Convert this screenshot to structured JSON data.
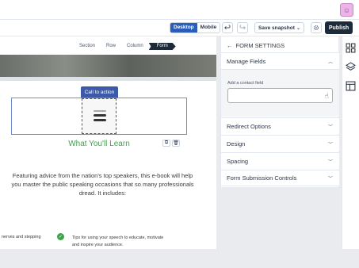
{
  "toolbar": {
    "desktop_label": "Desktop",
    "mobile_label": "Mobile",
    "undo_icon": "undo-icon",
    "redo_icon": "redo-icon",
    "save_snapshot_label": "Save snapshot",
    "settings_icon": "gear-icon",
    "publish_label": "Publish"
  },
  "canvas": {
    "breadcrumb": [
      "Section",
      "Row",
      "Column",
      "Form"
    ],
    "cta_tag": "Call to action",
    "heading": "What You'll Learn",
    "paragraph": "Featuring advice from the nation's top speakers, this e-book will help you master the public speaking occasions that so many professionals dread. It includes:",
    "bullet_left": "nerves and stepping",
    "bullet_right": "Tips for using your speech to educate, motivate and inspire your audience."
  },
  "panel": {
    "back_label": "FORM SETTINGS",
    "manage_fields": "Manage Fields",
    "add_field_label": "Add a contact field",
    "sections": [
      "Redirect Options",
      "Design",
      "Spacing",
      "Form Submission Controls"
    ]
  },
  "colors": {
    "accent": "#2b5db8",
    "publish": "#1d2a3a",
    "heading_green": "#3fa34d"
  }
}
